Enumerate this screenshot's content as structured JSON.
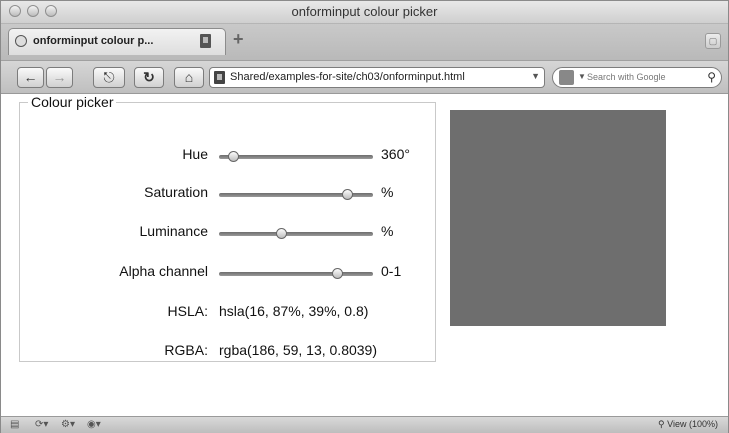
{
  "window": {
    "title": "onforminput colour picker"
  },
  "tab": {
    "label": "onforminput colour p..."
  },
  "toolbar": {
    "back_glyph": "←",
    "forward_glyph": "→",
    "reload_glyph": "↻",
    "home_glyph": "⌂",
    "url": "Shared/examples-for-site/ch03/onforminput.html",
    "search_placeholder": "Search with Google"
  },
  "form": {
    "legend": "Colour picker",
    "hue": {
      "label": "Hue",
      "unit": "360°",
      "value": 16,
      "min": 0,
      "max": 360
    },
    "saturation": {
      "label": "Saturation",
      "unit": "%",
      "value": 87,
      "min": 0,
      "max": 100
    },
    "luminance": {
      "label": "Luminance",
      "unit": "%",
      "value": 39,
      "min": 0,
      "max": 100
    },
    "alpha": {
      "label": "Alpha channel",
      "unit": "0-1",
      "value": 0.8,
      "min": 0,
      "max": 1
    },
    "hsla": {
      "label": "HSLA:",
      "value": "hsla(16, 87%, 39%, 0.8)"
    },
    "rgba": {
      "label": "RGBA:",
      "value": "rgba(186, 59, 13, 0.8039)"
    }
  },
  "preview": {
    "color": "#6e6e6e"
  },
  "statusbar": {
    "zoom": "View (100%)"
  }
}
